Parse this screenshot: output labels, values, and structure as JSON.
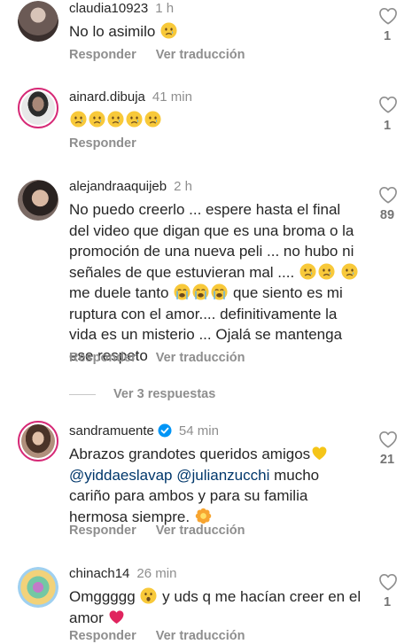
{
  "actions": {
    "reply": "Responder",
    "translate": "Ver traducción"
  },
  "comments": [
    {
      "user": "claudia10923",
      "time": "1 h",
      "likes": "1",
      "text": "No lo asimilo"
    },
    {
      "user": "ainard.dibuja",
      "time": "41 min",
      "likes": "1"
    },
    {
      "user": "alejandraaquijeb",
      "time": "2 h",
      "likes": "89",
      "p1": "No puedo creerlo ... espere hasta el final del video que digan que es una broma o la promoción de una nueva peli ... no hubo ni señales de que estuvieran mal ....",
      "p2": "me duele tanto",
      "p3": "que siento es mi ruptura con el amor.... definitivamente la vida es un misterio ... Ojalá se mantenga ese respeto",
      "replies": "Ver 3 respuestas"
    },
    {
      "user": "sandramuente",
      "time": "54 min",
      "likes": "21",
      "p1": "Abrazos grandotes queridos amigos",
      "m1": "@yiddaeslavap",
      "m2": "@julianzucchi",
      "p2": "mucho cariño para ambos y para su familia hermosa siempre."
    },
    {
      "user": "chinach14",
      "time": "26 min",
      "likes": "1",
      "p1": "Omggggg",
      "p2": "y uds q me hacían creer en el amor"
    }
  ],
  "icons": {
    "like": "heart-outline-icon",
    "verified": "verified-badge-icon"
  },
  "colors": {
    "mention": "#00376b",
    "muted": "#8e8e8e",
    "story_ring": "#d62976",
    "verified": "#0095f6"
  }
}
